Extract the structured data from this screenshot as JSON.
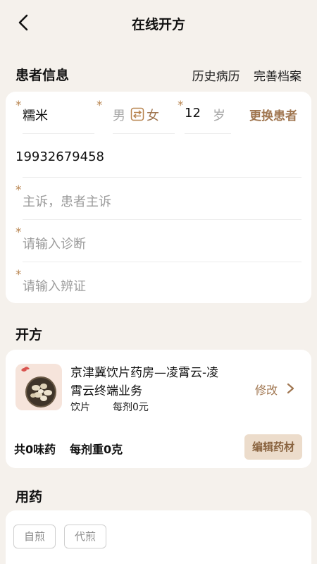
{
  "nav": {
    "title": "在线开方"
  },
  "patient": {
    "section_title": "患者信息",
    "links": [
      "历史病历",
      "完善档案"
    ],
    "name": "糯米",
    "gender_male": "男",
    "gender_female": "女",
    "age": "12",
    "age_unit": "岁",
    "change_patient": "更换患者",
    "phone": "19932679458",
    "complaint_placeholder": "主诉，患者主诉",
    "diagnosis_placeholder": "请输入诊断",
    "syndrome_placeholder": "请输入辨证",
    "required_mark": "*"
  },
  "prescription": {
    "section_title": "开方",
    "pharmacy_name_line1": "京津冀饮片药房—凌霄云-凌",
    "pharmacy_name_line2": "霄云终端业务",
    "type": "饮片",
    "price": "每剂0元",
    "modify": "修改",
    "summary_count": "共0味药",
    "summary_weight": "每剂重0克",
    "edit_button": "编辑药材"
  },
  "usage": {
    "section_title": "用药",
    "options": [
      "自煎",
      "代煎"
    ]
  },
  "colors": {
    "accent": "#a07650",
    "background": "#f5f1ec"
  }
}
